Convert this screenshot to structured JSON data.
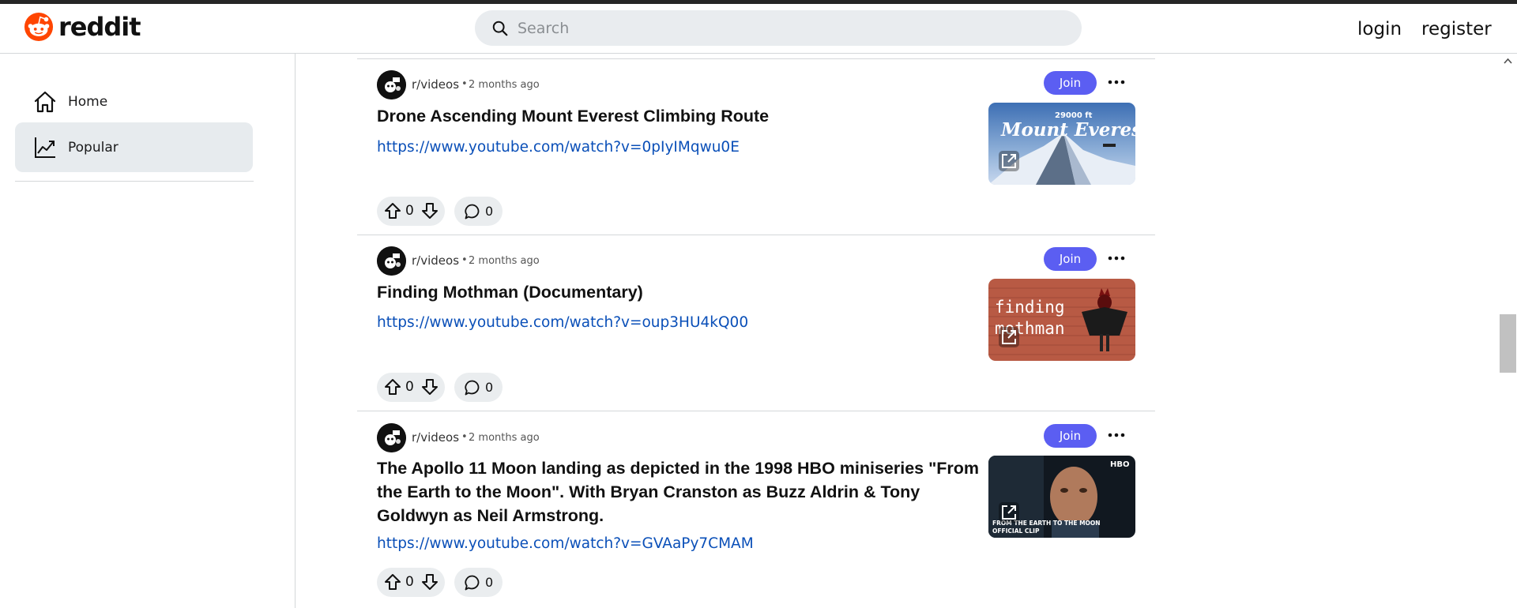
{
  "app": {
    "brand_name": "reddit"
  },
  "header": {
    "search_placeholder": "Search",
    "login_label": "login",
    "register_label": "register"
  },
  "sidebar": {
    "items": [
      {
        "label": "Home",
        "icon": "home-icon"
      },
      {
        "label": "Popular",
        "icon": "trending-icon",
        "active": true
      }
    ]
  },
  "colors": {
    "join_button": "#5b5ef2",
    "link": "#0a4fb8",
    "active_nav": "#e7ebee",
    "pill_bg": "#eaedef"
  },
  "posts": [
    {
      "subreddit": "r/videos",
      "separator": "•",
      "time": "2 months ago",
      "join_label": "Join",
      "title": "Drone Ascending Mount Everest Climbing Route",
      "url": "https://www.youtube.com/watch?v=0pIyIMqwu0E",
      "votes": "0",
      "comments": "0",
      "thumb_text_top": "29000 ft",
      "thumb_text_main": "Mount Everest"
    },
    {
      "subreddit": "r/videos",
      "separator": "•",
      "time": "2 months ago",
      "join_label": "Join",
      "title": "Finding Mothman (Documentary)",
      "url": "https://www.youtube.com/watch?v=oup3HU4kQ00",
      "votes": "0",
      "comments": "0",
      "thumb_text_line1": "finding",
      "thumb_text_line2": "mothman"
    },
    {
      "subreddit": "r/videos",
      "separator": "•",
      "time": "2 months ago",
      "join_label": "Join",
      "title": "The Apollo 11 Moon landing as depicted in the 1998 HBO miniseries \"From the Earth to the Moon\". With Bryan Cranston as Buzz Aldrin & Tony Goldwyn as Neil Armstrong.",
      "url": "https://www.youtube.com/watch?v=GVAaPy7CMAM",
      "votes": "0",
      "comments": "0",
      "thumb_badge": "HBO",
      "thumb_caption_1": "FROM THE EARTH TO THE MOON",
      "thumb_caption_2": "OFFICIAL CLIP"
    }
  ]
}
